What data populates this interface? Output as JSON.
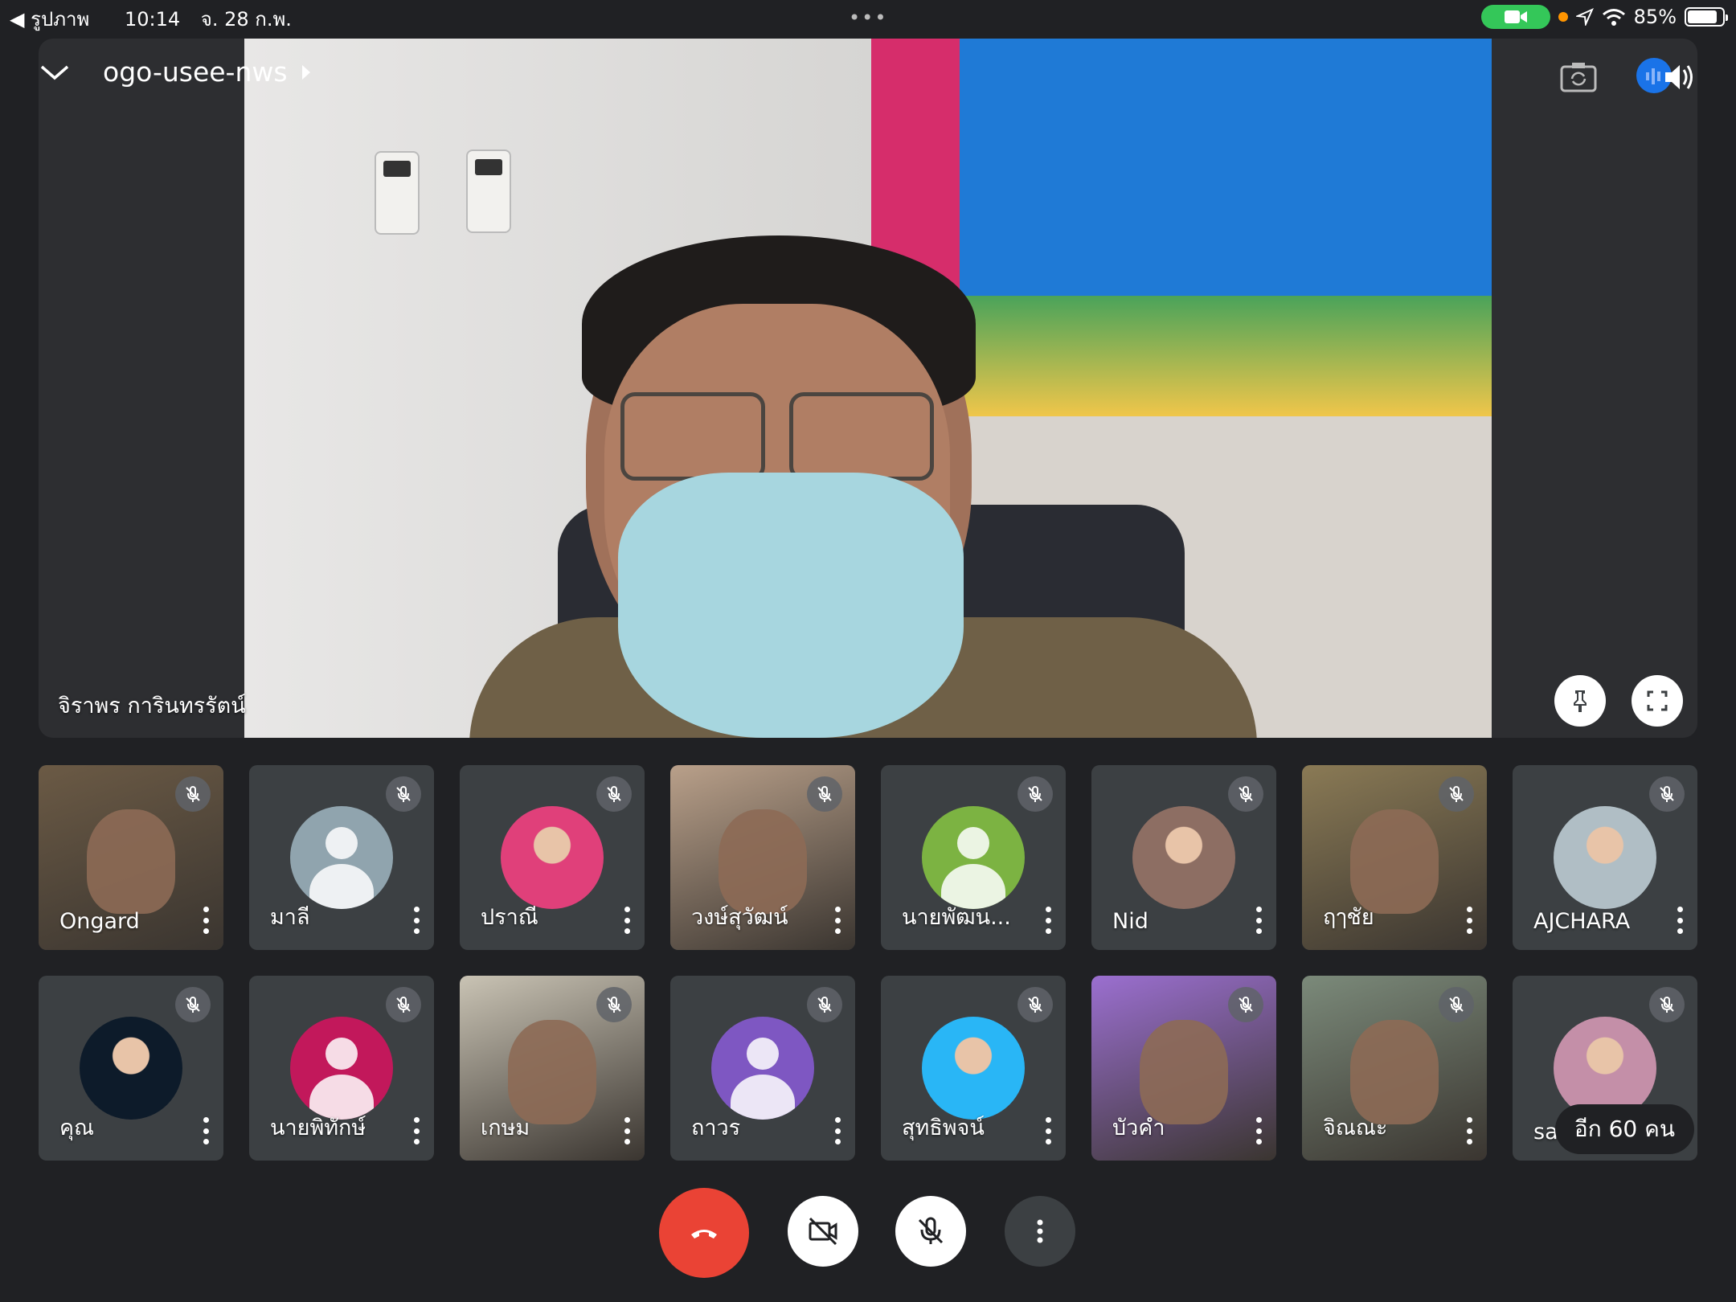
{
  "status_bar": {
    "back_app": "รูปภาพ",
    "time": "10:14",
    "date": "จ. 28 ก.พ.",
    "battery": "85%",
    "battery_level": 0.85,
    "camera_in_use_color": "#34c759",
    "indicator_color": "#ff9500"
  },
  "header": {
    "meeting_code": "ogo-usee-nws",
    "collapse_icon": "chevron-down-icon",
    "switch_camera_icon": "switch-camera-icon",
    "speaker_icon": "speaker-icon"
  },
  "stage": {
    "speaker_name": "จิราพร การินทรรัตน์",
    "pin_icon": "pin-icon",
    "fullscreen_icon": "fullscreen-icon"
  },
  "participants": [
    {
      "name": "Ongard",
      "type": "video",
      "bg": "#6b5a45"
    },
    {
      "name": "มาลี",
      "type": "avatar",
      "color": "#90a4ae"
    },
    {
      "name": "ปราณี",
      "type": "photo",
      "color": "#e0407a"
    },
    {
      "name": "วงษ์สุวัฒน์",
      "type": "video",
      "bg": "#b9a08a"
    },
    {
      "name": "นายพัฒน...",
      "type": "avatar",
      "color": "#7cb342"
    },
    {
      "name": "Nid",
      "type": "photo",
      "color": "#8d6e63"
    },
    {
      "name": "ฤๅชัย",
      "type": "video",
      "bg": "#8a7a55"
    },
    {
      "name": "AJCHARA",
      "type": "photo",
      "color": "#b0bec5"
    },
    {
      "name": "คุณ",
      "type": "photo",
      "color": "#0d1b2a"
    },
    {
      "name": "นายพิทักษ์",
      "type": "avatar",
      "color": "#c2185b"
    },
    {
      "name": "เกษม",
      "type": "video",
      "bg": "#c9c3b4"
    },
    {
      "name": "ถาวร",
      "type": "avatar",
      "color": "#7e57c2"
    },
    {
      "name": "สุทธิพจน์",
      "type": "photo",
      "color": "#29b6f6"
    },
    {
      "name": "บัวคำ",
      "type": "video",
      "bg": "#9b6fd0"
    },
    {
      "name": "จิณณะ",
      "type": "video",
      "bg": "#7b8a7a"
    },
    {
      "name": "sa",
      "type": "photo",
      "color": "#c48fa8"
    }
  ],
  "others_count": "อีก 60 คน",
  "controls": {
    "end_call_color": "#ea4335",
    "end_call_icon": "end-call-icon",
    "camera_off_icon": "camera-off-icon",
    "mic_off_icon": "mic-off-icon",
    "more_icon": "more-vertical-icon"
  }
}
